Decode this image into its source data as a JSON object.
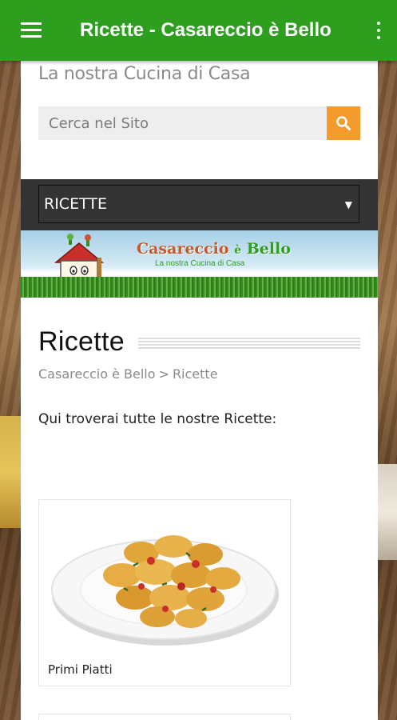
{
  "appbar": {
    "title": "Ricette - Casareccio è Bello",
    "color": "#2e9e1f"
  },
  "header": {
    "tagline": "La nostra Cucina di Casa"
  },
  "search": {
    "placeholder": "Cerca nel Sito",
    "button_color": "#f59b2d"
  },
  "nav": {
    "selected": "RICETTE"
  },
  "banner": {
    "logo_title_part1": "Casareccio",
    "logo_title_part2": "è",
    "logo_title_part3": "Bello",
    "logo_subtitle": "La nostra Cucina di Casa"
  },
  "page": {
    "title": "Ricette",
    "breadcrumb": [
      "Casareccio è Bello",
      "Ricette"
    ],
    "breadcrumb_separator": ">",
    "intro": "Qui troverai tutte le nostre Ricette:"
  },
  "cards": [
    {
      "label": "Primi Piatti",
      "image": "tortellini-plate"
    }
  ]
}
